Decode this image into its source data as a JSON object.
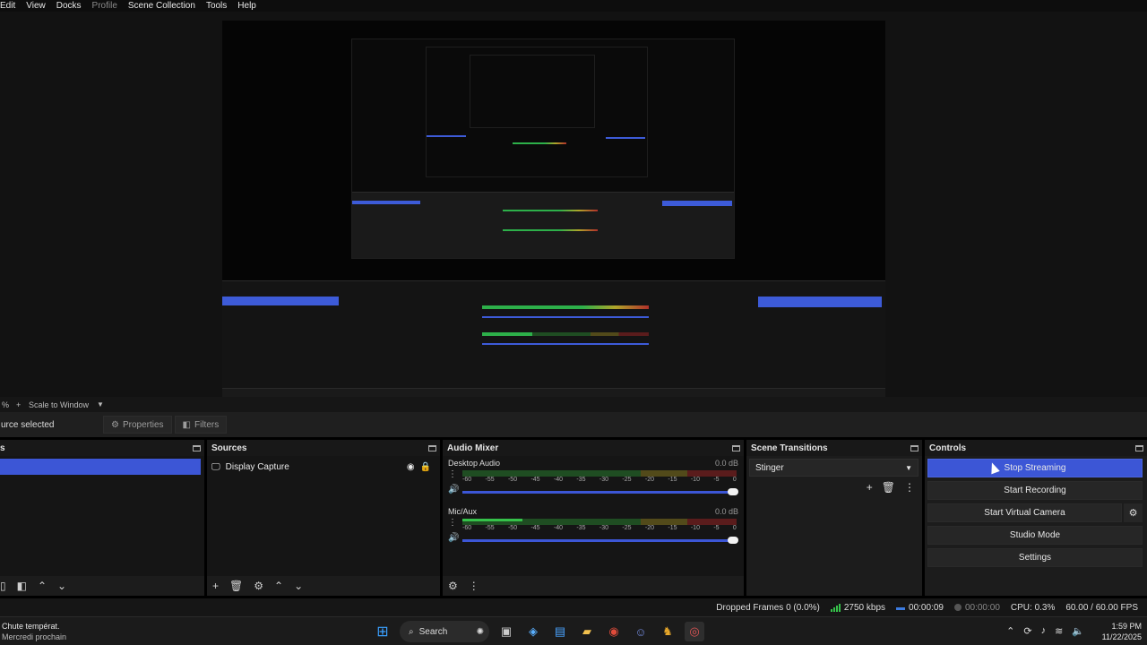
{
  "menu": {
    "items": [
      "Edit",
      "View",
      "Docks",
      "Profile",
      "Scene Collection",
      "Tools",
      "Help"
    ],
    "disabled_item": "Profile"
  },
  "preview": {
    "scale_label": "Scale to Window"
  },
  "toolbar": {
    "source_status": "urce selected",
    "properties_label": "Properties",
    "filters_label": "Filters"
  },
  "docks": {
    "scenes": {
      "title": "s"
    },
    "sources": {
      "title": "Sources",
      "items": [
        {
          "label": "Display Capture"
        }
      ]
    },
    "audio_mixer": {
      "title": "Audio Mixer",
      "ticks": [
        "-60",
        "-55",
        "-50",
        "-45",
        "-40",
        "-35",
        "-30",
        "-25",
        "-20",
        "-15",
        "-10",
        "-5",
        "0"
      ],
      "channels": [
        {
          "name": "Desktop Audio",
          "db": "0.0 dB",
          "level": 0.0
        },
        {
          "name": "Mic/Aux",
          "db": "0.0 dB",
          "level": 0.22
        }
      ]
    },
    "scene_transitions": {
      "title": "Scene Transitions",
      "selected": "Stinger"
    },
    "controls": {
      "title": "Controls",
      "buttons": [
        "Stop Streaming",
        "Start Recording",
        "Start Virtual Camera",
        "Studio Mode",
        "Settings"
      ]
    }
  },
  "status": {
    "dropped_frames": "Dropped Frames 0 (0.0%)",
    "bitrate": "2750 kbps",
    "stream_time": "00:00:09",
    "record_time": "00:00:00",
    "cpu": "CPU: 0.3%",
    "fps": "60.00 / 60.00 FPS"
  },
  "taskbar": {
    "weather_line1": "Chute températ.",
    "weather_line2": "Mercredi prochain",
    "search_label": "Search",
    "time": "1:59 PM",
    "date": "11/22/2025"
  },
  "colors": {
    "accent": "#3c56d6",
    "meter_green": "#35c24a"
  }
}
